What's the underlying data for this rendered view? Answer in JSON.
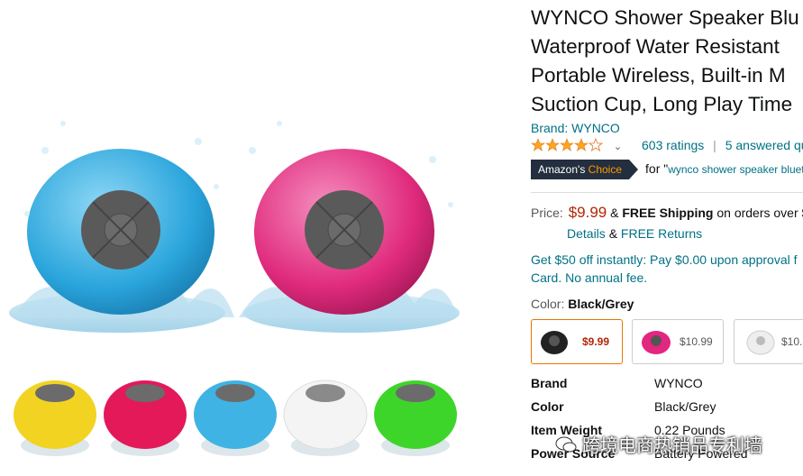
{
  "product": {
    "title_lines": [
      "WYNCO Shower Speaker Blu",
      "Waterproof Water Resistant",
      "Portable Wireless, Built-in M",
      "Suction Cup, Long Play Time"
    ],
    "brand": "Brand: WYNCO",
    "rating_stars": 4.3,
    "ratings_count": "603 ratings",
    "separator": "|",
    "answered": "5 answered qu",
    "choice_badge_prefix": "Amazon's ",
    "choice_badge_highlight": "Choice",
    "choice_for": "for \"",
    "choice_query": "wynco shower speaker bluet"
  },
  "price": {
    "label": "Price:",
    "value": "$9.99",
    "amp": "&",
    "free_shipping": "FREE Shipping",
    "shipping_rest": "on orders over $",
    "details": "Details",
    "amp2": "&",
    "free_returns": "FREE Returns"
  },
  "promo": {
    "line1": "Get $50 off instantly: Pay $0.00 upon approval f",
    "line2": "Card. No annual fee."
  },
  "color": {
    "label": "Color:",
    "value": "Black/Grey",
    "swatches": [
      {
        "price": "$9.99",
        "color": "#222222"
      },
      {
        "price": "$10.99",
        "color": "#e3267f"
      },
      {
        "price": "$10.",
        "color": "#eeeeee"
      }
    ]
  },
  "specs": [
    {
      "label": "Brand",
      "value": "WYNCO"
    },
    {
      "label": "Color",
      "value": "Black/Grey"
    },
    {
      "label": "Item Weight",
      "value": "0.22 Pounds"
    },
    {
      "label": "Power Source",
      "value": "Battery Powered"
    }
  ],
  "watermark": "跨境电商热销品专利墙",
  "colors": {
    "link": "#007185",
    "price": "#b12704",
    "badge": "#232f3e",
    "accent": "#ff9900",
    "speaker_blue": "#3fb3e3",
    "speaker_pink": "#e4307f",
    "speaker_yellow": "#f2d321",
    "speaker_red": "#e3195a",
    "speaker_white": "#f4f4f4",
    "speaker_green": "#3ed52b"
  }
}
